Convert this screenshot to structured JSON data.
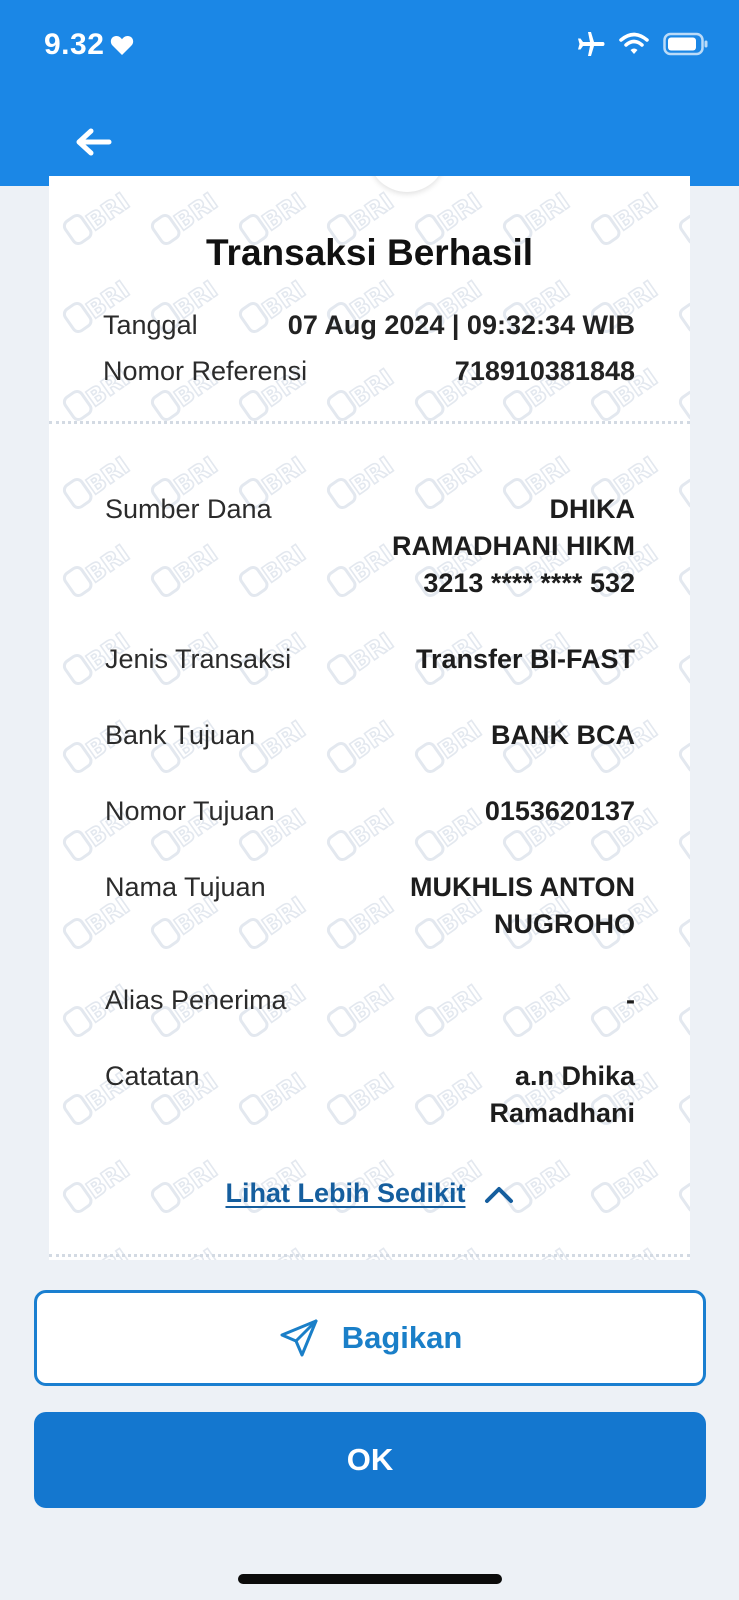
{
  "status_bar": {
    "time": "9.32",
    "icons": [
      "heart-icon",
      "airplane-icon",
      "wifi-icon",
      "battery-icon"
    ]
  },
  "colors": {
    "header": "#1b87e6",
    "primary_button": "#1477cf",
    "link": "#155e9e",
    "background": "#edf1f6"
  },
  "receipt": {
    "title": "Transaksi Berhasil",
    "meta": [
      {
        "label": "Tanggal",
        "value": "07 Aug 2024 | 09:32:34 WIB"
      },
      {
        "label": "Nomor Referensi",
        "value": "718910381848"
      }
    ],
    "details": [
      {
        "label": "Sumber Dana",
        "value": "DHIKA\nRAMADHANI HIKM\n3213 **** **** 532"
      },
      {
        "label": "Jenis Transaksi",
        "value": "Transfer BI-FAST"
      },
      {
        "label": "Bank Tujuan",
        "value": "BANK BCA"
      },
      {
        "label": "Nomor Tujuan",
        "value": "0153620137"
      },
      {
        "label": "Nama Tujuan",
        "value": "MUKHLIS ANTON\nNUGROHO"
      },
      {
        "label": "Alias Penerima",
        "value": "-"
      },
      {
        "label": "Catatan",
        "value": "a.n Dhika\nRamadhani"
      }
    ],
    "toggle_label": "Lihat Lebih Sedikit",
    "watermark": "BRI"
  },
  "actions": {
    "share_label": "Bagikan",
    "ok_label": "OK"
  }
}
